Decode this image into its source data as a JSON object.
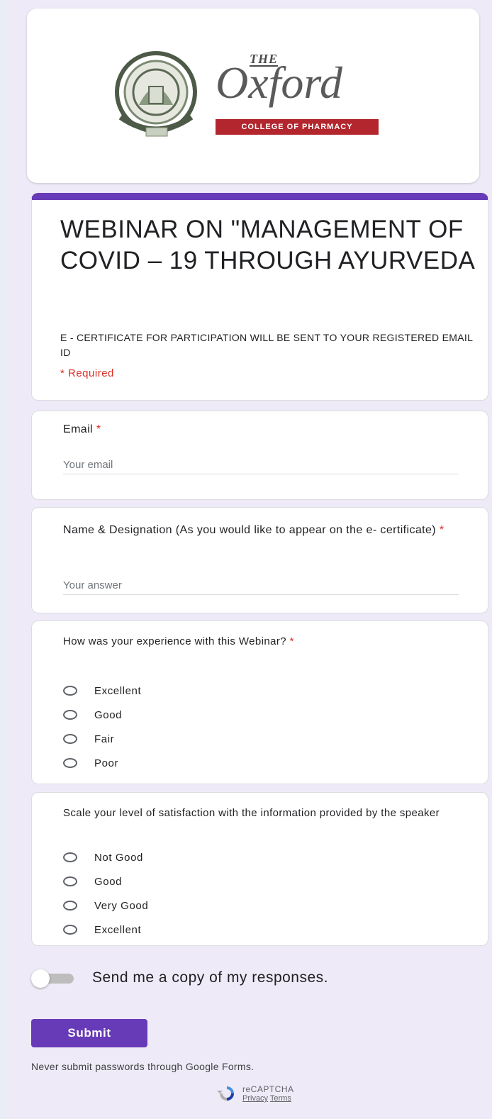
{
  "header": {
    "logo_the": "THE",
    "logo_wordmark": "Oxford",
    "logo_college": "COLLEGE OF PHARMACY"
  },
  "form": {
    "title": "WEBINAR ON \"MANAGEMENT OF COVID – 19 THROUGH AYURVEDA",
    "description": "E - CERTIFICATE FOR PARTICIPATION WILL BE SENT TO YOUR REGISTERED EMAIL ID",
    "required_note": "* Required"
  },
  "questions": {
    "email": {
      "label": "Email",
      "required_mark": "*",
      "placeholder": "Your email"
    },
    "name": {
      "label": "Name & Designation (As you would like to appear on the e- certificate)",
      "required_mark": "*",
      "placeholder": "Your answer"
    },
    "experience": {
      "label": "How was your experience with this Webinar?",
      "required_mark": "*",
      "options": [
        "Excellent",
        "Good",
        "Fair",
        "Poor"
      ]
    },
    "satisfaction": {
      "label": "Scale your level of satisfaction with the information provided by the speaker",
      "options": [
        "Not Good",
        "Good",
        "Very Good",
        "Excellent"
      ]
    }
  },
  "footer": {
    "copy_label": "Send me a copy of my responses.",
    "submit_label": "Submit",
    "never_note": "Never submit passwords through Google Forms.",
    "recaptcha": "reCAPTCHA",
    "privacy": "Privacy",
    "terms": "Terms"
  },
  "colors": {
    "accent": "#673ab7",
    "required": "#d93025",
    "background": "#efeaf7"
  },
  "icons": {
    "recaptcha": "recaptcha-icon",
    "seal": "college-seal-icon"
  }
}
